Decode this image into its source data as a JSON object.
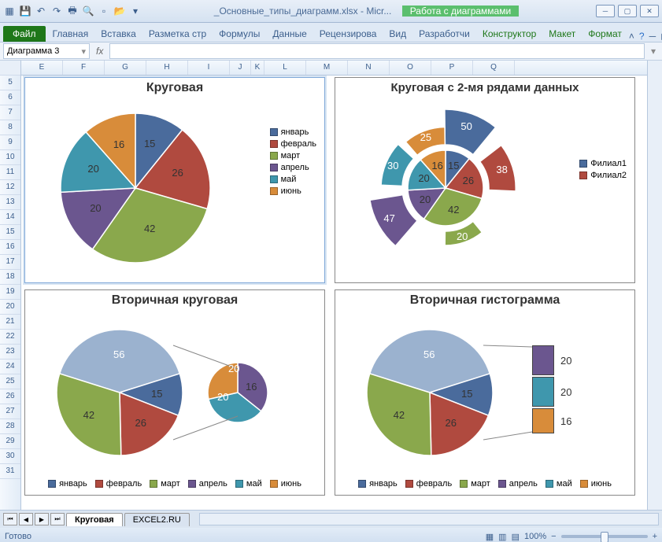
{
  "title": "_Основные_типы_диаграмм.xlsx - Micr...",
  "ctx_tab": "Работа с диаграммами",
  "qat": [
    "excel",
    "save",
    "undo",
    "redo",
    "print",
    "preview",
    "new",
    "open",
    "more"
  ],
  "ribbon": {
    "file": "Файл",
    "tabs": [
      "Главная",
      "Вставка",
      "Разметка стр",
      "Формулы",
      "Данные",
      "Рецензирова",
      "Вид",
      "Разработчи"
    ],
    "ctx": [
      "Конструктор",
      "Макет",
      "Формат"
    ]
  },
  "namebox": "Диаграмма 3",
  "cols": [
    "E",
    "F",
    "G",
    "H",
    "I",
    "J",
    "K",
    "L",
    "M",
    "N",
    "O",
    "P",
    "Q"
  ],
  "rows": [
    5,
    6,
    7,
    8,
    9,
    10,
    11,
    12,
    13,
    14,
    15,
    16,
    17,
    18,
    19,
    20,
    21,
    22,
    23,
    24,
    25,
    26,
    27,
    28,
    29,
    30,
    31
  ],
  "colors": {
    "jan": "#4a6b9c",
    "feb": "#b04a3f",
    "mar": "#8aa84c",
    "apr": "#6b568f",
    "may": "#3f97ad",
    "jun": "#d88c3a"
  },
  "months": [
    "январь",
    "февраль",
    "март",
    "апрель",
    "май",
    "июнь"
  ],
  "chart_data": [
    {
      "type": "pie",
      "title": "Круговая",
      "categories": [
        "январь",
        "февраль",
        "март",
        "апрель",
        "май",
        "июнь"
      ],
      "values": [
        15,
        26,
        42,
        20,
        20,
        16
      ],
      "legend": "right"
    },
    {
      "type": "pie",
      "title": "Круговая с 2-мя рядами данных",
      "categories": [
        "январь",
        "февраль",
        "март",
        "апрель",
        "май",
        "июнь"
      ],
      "series": [
        {
          "name": "Филиал1",
          "values": [
            15,
            26,
            42,
            20,
            20,
            16
          ]
        },
        {
          "name": "Филиал2",
          "values": [
            50,
            38,
            20,
            47,
            30,
            25
          ]
        }
      ],
      "legend": "right",
      "legend_entries": [
        "Филиал1",
        "Филиал2"
      ]
    },
    {
      "type": "pie",
      "subtype": "secondary-pie",
      "title": "Вторичная круговая",
      "main_categories": [
        "январь",
        "февраль",
        "март",
        "other"
      ],
      "main_values": [
        15,
        26,
        42,
        56
      ],
      "secondary_categories": [
        "апрель",
        "май",
        "июнь"
      ],
      "secondary_values": [
        20,
        20,
        16
      ],
      "legend": "bottom"
    },
    {
      "type": "pie",
      "subtype": "secondary-bar",
      "title": "Вторичная гистограмма",
      "main_categories": [
        "январь",
        "февраль",
        "март",
        "other"
      ],
      "main_values": [
        15,
        26,
        42,
        56
      ],
      "secondary_categories": [
        "апрель",
        "май",
        "июнь"
      ],
      "secondary_values": [
        20,
        20,
        16
      ],
      "legend": "bottom"
    }
  ],
  "sheets": {
    "active": "Круговая",
    "other": "EXCEL2.RU"
  },
  "status": {
    "ready": "Готово",
    "zoom": "100%"
  }
}
